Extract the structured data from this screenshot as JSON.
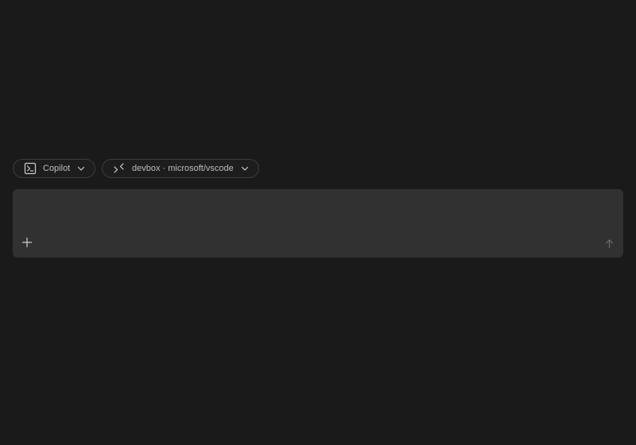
{
  "chips": {
    "agent": {
      "label": "Copilot",
      "icon": "terminal-icon"
    },
    "target": {
      "label": "devbox · microsoft/vscode",
      "icon": "remote-icon"
    }
  },
  "prompt": {
    "value": "",
    "placeholder": ""
  },
  "actions": {
    "add_icon": "plus-icon",
    "send_icon": "arrow-up-icon"
  },
  "colors": {
    "background": "#1a1a1a",
    "input_background": "#313131",
    "chip_border": "#3c3c3c",
    "text": "#bdbdbd"
  }
}
